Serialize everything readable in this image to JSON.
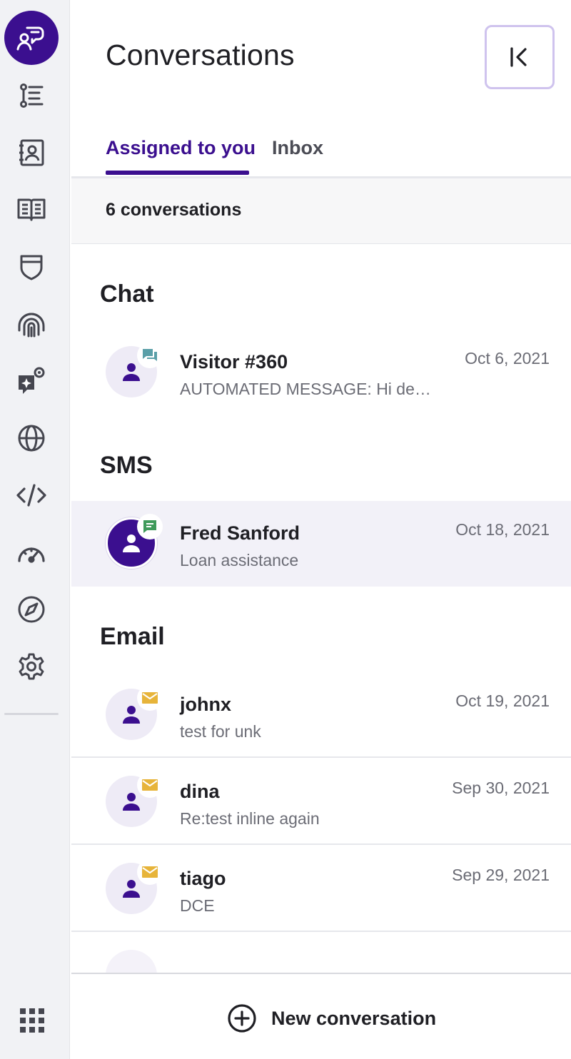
{
  "brand": {
    "accent": "#3b0f8f",
    "chat_badge": "#5a9fa8",
    "sms_badge": "#3f9a5a",
    "email_badge": "#e7b43a"
  },
  "rail": {
    "items": [
      {
        "icon": "workflow-list-icon"
      },
      {
        "icon": "contacts-book-icon"
      },
      {
        "icon": "knowledge-book-icon"
      },
      {
        "icon": "shield-icon"
      },
      {
        "icon": "fingerprint-icon"
      },
      {
        "icon": "ai-settings-icon"
      },
      {
        "icon": "globe-icon"
      },
      {
        "icon": "code-icon"
      },
      {
        "icon": "dashboard-gauge-icon"
      },
      {
        "icon": "compass-icon"
      },
      {
        "icon": "settings-gear-icon"
      }
    ]
  },
  "header": {
    "title": "Conversations"
  },
  "tabs": [
    {
      "label": "Assigned to you",
      "active": true
    },
    {
      "label": "Inbox",
      "active": false
    }
  ],
  "count_label": "6 conversations",
  "sections": [
    {
      "title": "Chat",
      "items": [
        {
          "name": "Visitor #360",
          "preview": "AUTOMATED MESSAGE: Hi dea…",
          "date": "Oct 6, 2021",
          "channel": "chat",
          "selected": false
        }
      ]
    },
    {
      "title": "SMS",
      "items": [
        {
          "name": "Fred Sanford",
          "preview": "Loan assistance",
          "date": "Oct 18, 2021",
          "channel": "sms",
          "selected": true
        }
      ]
    },
    {
      "title": "Email",
      "items": [
        {
          "name": "johnx",
          "preview": "test for unk",
          "date": "Oct 19, 2021",
          "channel": "email",
          "selected": false
        },
        {
          "name": "dina",
          "preview": "Re:test inline again",
          "date": "Sep 30, 2021",
          "channel": "email",
          "selected": false
        },
        {
          "name": "tiago",
          "preview": "DCE",
          "date": "Sep 29, 2021",
          "channel": "email",
          "selected": false
        }
      ]
    }
  ],
  "footer": {
    "new_conversation_label": "New conversation"
  }
}
